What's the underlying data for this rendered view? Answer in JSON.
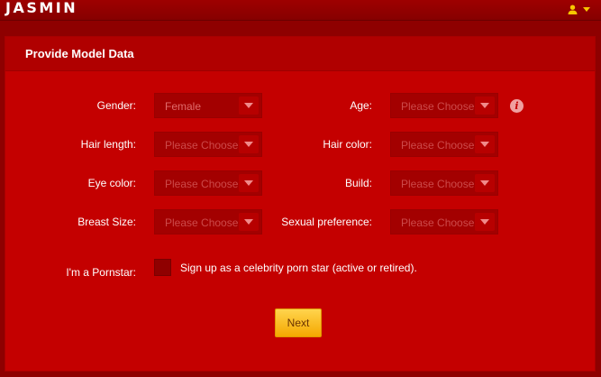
{
  "app": {
    "logo": "JASMIN"
  },
  "panel": {
    "title": "Provide Model Data"
  },
  "fields": {
    "gender": {
      "label": "Gender:",
      "value": "Female"
    },
    "age": {
      "label": "Age:",
      "value": "Please Choose"
    },
    "hair_length": {
      "label": "Hair length:",
      "value": "Please Choose"
    },
    "hair_color": {
      "label": "Hair color:",
      "value": "Please Choose"
    },
    "eye_color": {
      "label": "Eye color:",
      "value": "Please Choose"
    },
    "build": {
      "label": "Build:",
      "value": "Please Choose"
    },
    "breast_size": {
      "label": "Breast Size:",
      "value": "Please Choose"
    },
    "sexual_pref": {
      "label": "Sexual preference:",
      "value": "Please Choose"
    }
  },
  "pornstar": {
    "label": "I'm a Pornstar:",
    "checkbox_text": "Sign up as a celebrity porn star (active or retired)."
  },
  "actions": {
    "next_label": "Next"
  },
  "colors": {
    "background": "#8e0000",
    "panel": "#c40000",
    "accent": "#f5a800",
    "user_icon": "#f7c600"
  },
  "icons": {
    "user": "user-icon",
    "caret": "caret-down-icon",
    "info": "info-icon",
    "select_arrow": "chevron-down-icon"
  }
}
